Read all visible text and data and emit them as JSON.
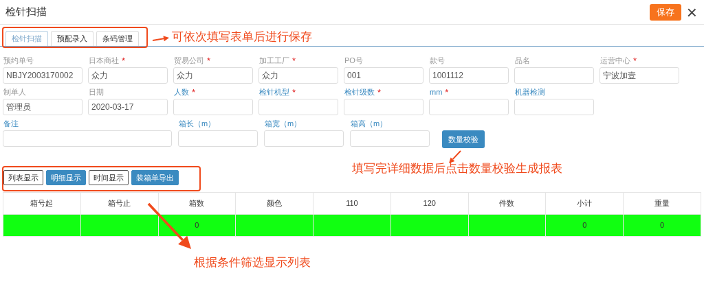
{
  "window": {
    "title": "检针扫描",
    "save_button": "保存",
    "close_button": "×"
  },
  "tabs": [
    {
      "label": "检针扫描",
      "selected": true
    },
    {
      "label": "预配录入",
      "selected": false
    },
    {
      "label": "条码管理",
      "selected": false
    }
  ],
  "form": {
    "rows": [
      [
        {
          "label": "预约单号",
          "readonly": true,
          "value": "NBJY2003170002"
        },
        {
          "label": "日本商社",
          "required_mark": "*",
          "readonly": true,
          "value": "众力"
        },
        {
          "label": "贸易公司",
          "required_mark": "*",
          "readonly": true,
          "value": "众力"
        },
        {
          "label": "加工工厂",
          "required_mark": "*",
          "readonly": true,
          "value": "众力"
        },
        {
          "label": "PO号",
          "readonly": true,
          "value": "001"
        },
        {
          "label": "款号",
          "readonly": true,
          "value": "1001112"
        },
        {
          "label": "品名",
          "readonly": true
        },
        {
          "label": "运营中心",
          "required_mark": "*",
          "readonly": true,
          "value": "宁波加壹"
        }
      ],
      [
        {
          "label": "制单人",
          "readonly": true,
          "value": "管理员"
        },
        {
          "label": "日期",
          "readonly": true,
          "value": "2020-03-17"
        },
        {
          "label": "人数",
          "required_mark": "*",
          "readonly": false
        },
        {
          "label": "检针机型",
          "required_mark": "*",
          "readonly": false
        },
        {
          "label": "检针级数",
          "required_mark": "*",
          "readonly": false
        },
        {
          "label": "mm",
          "required_mark": "*",
          "readonly": false
        },
        {
          "label": "机器检测",
          "readonly": false
        }
      ]
    ]
  },
  "box_size": {
    "fields": [
      {
        "kind": "wide",
        "label": "备注",
        "readonly": false
      },
      {
        "kind": "field",
        "label": "箱长（m）",
        "readonly": false
      },
      {
        "kind": "field",
        "label": "箱宽（m）",
        "readonly": false
      },
      {
        "kind": "field",
        "label": "箱高（m）",
        "readonly": false
      }
    ],
    "check_button": "数量校验"
  },
  "view_buttons": [
    {
      "label": "列表显示",
      "kind": "outline"
    },
    {
      "label": "明细显示",
      "kind": "primary"
    },
    {
      "label": "时间显示",
      "kind": "outline"
    },
    {
      "label": "装箱单导出",
      "kind": "primary"
    }
  ],
  "table": {
    "columns": [
      "箱号起",
      "箱号止",
      "箱数",
      "颜色",
      "110",
      "120",
      "件数",
      "小计",
      "重量"
    ],
    "rows": [
      {
        "color": "#11ff11",
        "cells": [
          "",
          "",
          "0",
          "",
          "",
          "",
          "",
          "0",
          "0"
        ]
      }
    ]
  },
  "annotations": [
    {
      "text": "可依次填写表单后进行保存"
    },
    {
      "text": "填写完详细数据后点击数量校验生成报表"
    },
    {
      "text": "根据条件筛选显示列表"
    }
  ]
}
